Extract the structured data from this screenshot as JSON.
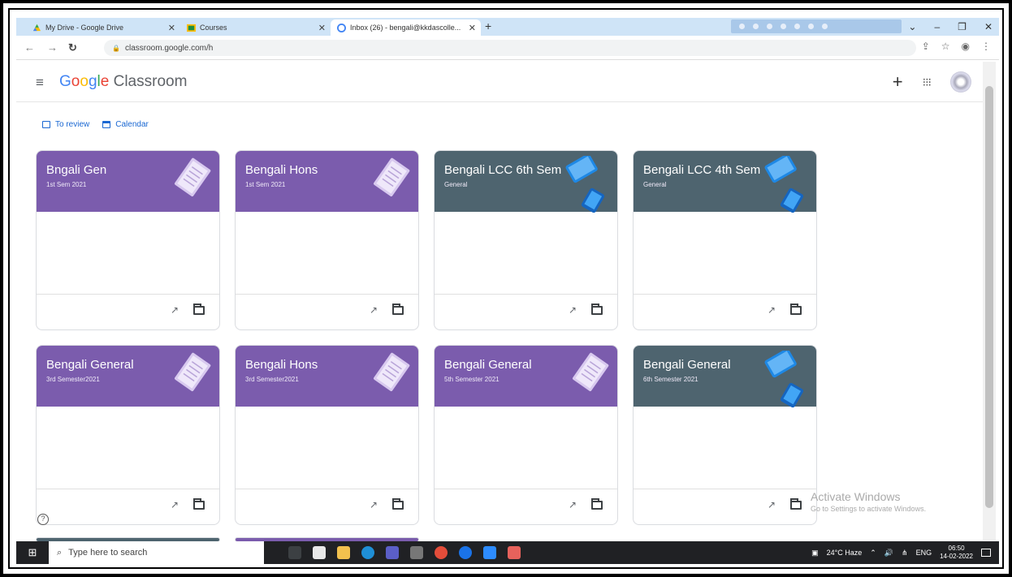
{
  "browser": {
    "tabs": [
      {
        "title": "My Drive - Google Drive",
        "close": "✕",
        "icon": "google-drive-icon"
      },
      {
        "title": "Courses",
        "close": "✕",
        "icon": "classroom-icon"
      },
      {
        "title": "Inbox (26) - bengali@kkdascolle...",
        "close": "✕",
        "icon": "gmail-icon"
      }
    ],
    "new_tab": "+",
    "url": "classroom.google.com/h"
  },
  "app": {
    "brand_google": "Google",
    "brand_rest": "Classroom",
    "links": [
      {
        "label": "To review"
      },
      {
        "label": "Calendar"
      }
    ]
  },
  "courses": [
    {
      "title": "Bngali Gen",
      "subtitle": "1st Sem 2021",
      "theme": "purple"
    },
    {
      "title": "Bengali Hons",
      "subtitle": "1st Sem 2021",
      "theme": "purple"
    },
    {
      "title": "Bengali LCC 6th Sem",
      "subtitle": "General",
      "theme": "slate"
    },
    {
      "title": "Bengali LCC 4th Sem",
      "subtitle": "General",
      "theme": "slate"
    },
    {
      "title": "Bengali General",
      "subtitle": "3rd Semester2021",
      "theme": "purple"
    },
    {
      "title": "Bengali Hons",
      "subtitle": "3rd Semester2021",
      "theme": "purple"
    },
    {
      "title": "Bengali General",
      "subtitle": "5th Semester 2021",
      "theme": "purple"
    },
    {
      "title": "Bengali General",
      "subtitle": "6th Semester 2021",
      "theme": "slate"
    }
  ],
  "watermark": {
    "line1": "Activate Windows",
    "line2": "Go to Settings to activate Windows."
  },
  "taskbar": {
    "search_placeholder": "Type here to search",
    "weather": "24°C Haze",
    "lang": "ENG",
    "time": "06:50",
    "date": "14-02-2022"
  },
  "colors": {
    "purple_banner": "#7b5cad",
    "slate_banner": "#4e646f",
    "link_blue": "#1967d2"
  }
}
